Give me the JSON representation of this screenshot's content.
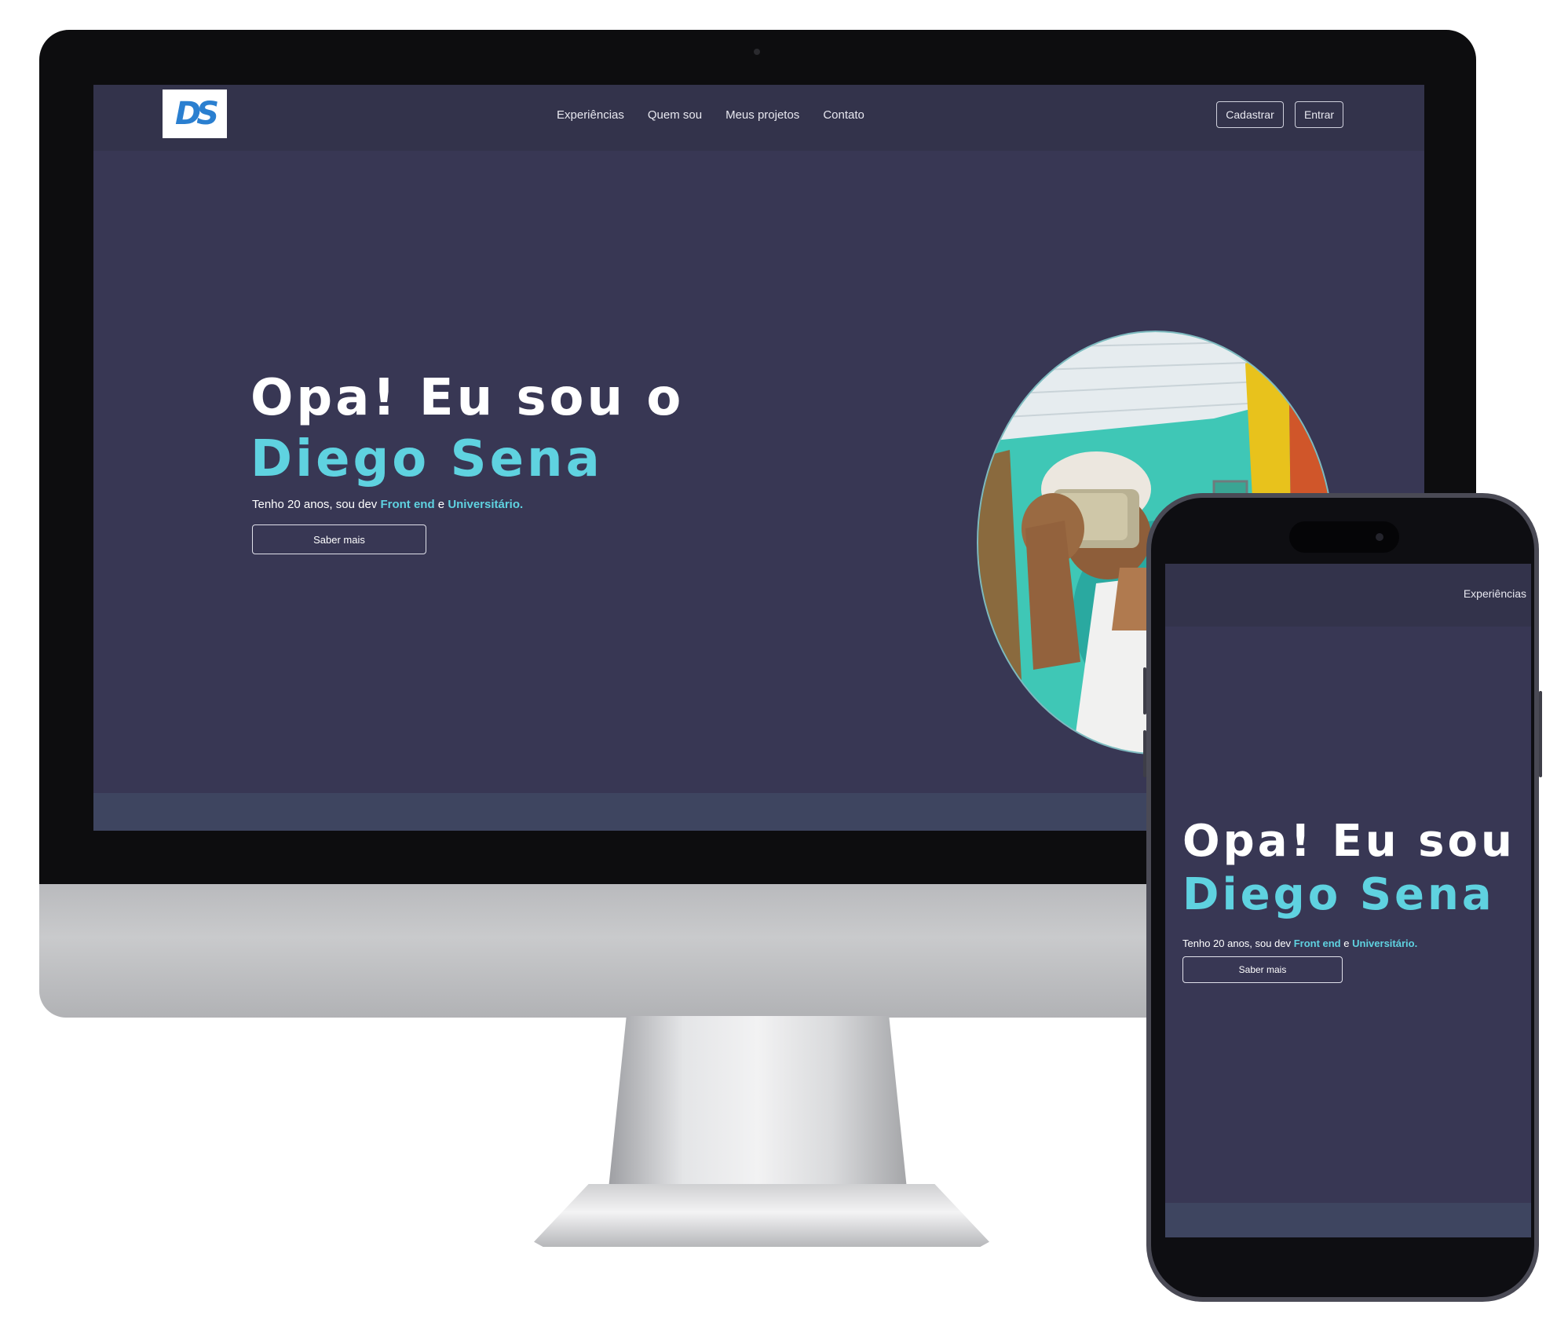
{
  "desktop": {
    "logo_text": "DS",
    "nav": {
      "links": [
        "Experiências",
        "Quem sou",
        "Meus projetos",
        "Contato"
      ],
      "buttons": {
        "register": "Cadastrar",
        "login": "Entrar"
      }
    },
    "hero": {
      "greeting": "Opa! Eu sou o",
      "name": "Diego Sena",
      "subtitle_prefix": "Tenho 20 anos, sou dev",
      "subtitle_front": "Front end",
      "subtitle_and": "e",
      "subtitle_uni": "Universitário.",
      "button": "Saber mais"
    }
  },
  "mobile": {
    "nav_link": "Experiências",
    "hero": {
      "greeting": "Opa! Eu sou o",
      "name": "Diego Sena",
      "subtitle_prefix": "Tenho 20 anos, sou dev",
      "subtitle_front": "Front end",
      "subtitle_and": "e",
      "subtitle_uni": "Universitário.",
      "button": "Saber mais"
    }
  },
  "colors": {
    "background": "#383754",
    "nav": "#33334b",
    "accent": "#5fd2e0"
  }
}
